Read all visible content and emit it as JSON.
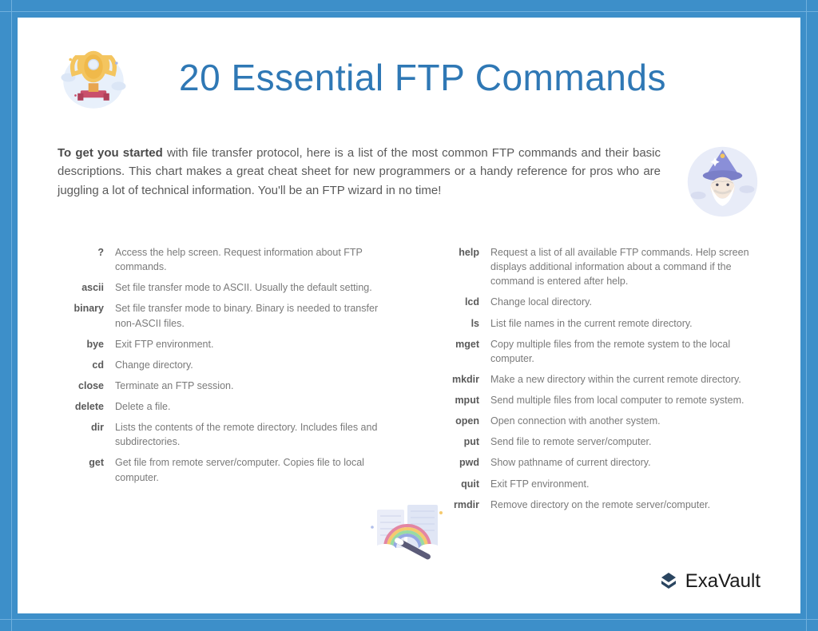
{
  "title": "20 Essential FTP Commands",
  "intro_lead": "To get you started",
  "intro_body": " with file transfer protocol, here is a list of the most common FTP commands and their basic descriptions. This chart makes a great cheat sheet for new programmers or a handy reference for pros who are juggling a lot of technical information. You'll be an FTP wizard in no time!",
  "brand": "ExaVault",
  "commands_left": [
    {
      "name": "?",
      "desc": "Access the help screen. Request information about FTP commands."
    },
    {
      "name": "ascii",
      "desc": "Set file transfer mode to ASCII. Usually the default setting."
    },
    {
      "name": "binary",
      "desc": "Set file transfer mode to binary. Binary is needed to transfer non-ASCII files."
    },
    {
      "name": "bye",
      "desc": "Exit FTP environment."
    },
    {
      "name": "cd",
      "desc": "Change directory."
    },
    {
      "name": "close",
      "desc": "Terminate an FTP session."
    },
    {
      "name": "delete",
      "desc": "Delete a file."
    },
    {
      "name": "dir",
      "desc": "Lists the contents of the remote directory. Includes files and subdirectories."
    },
    {
      "name": "get",
      "desc": "Get file from remote server/computer. Copies file to local computer."
    }
  ],
  "commands_right": [
    {
      "name": "help",
      "desc": "Request a list of all available FTP commands. Help screen displays additional information about a command if the command is entered after help."
    },
    {
      "name": "lcd",
      "desc": "Change local directory."
    },
    {
      "name": "ls",
      "desc": "List file names in the current remote directory."
    },
    {
      "name": "mget",
      "desc": "Copy multiple files from the remote system to the local computer."
    },
    {
      "name": "mkdir",
      "desc": "Make a new directory within the current remote directory."
    },
    {
      "name": "mput",
      "desc": "Send multiple files from local computer to remote system."
    },
    {
      "name": "open",
      "desc": "Open connection with another system."
    },
    {
      "name": "put",
      "desc": "Send file to remote server/computer."
    },
    {
      "name": "pwd",
      "desc": "Show pathname of current directory."
    },
    {
      "name": "quit",
      "desc": "Exit FTP environment."
    },
    {
      "name": "rmdir",
      "desc": "Remove directory on the remote server/computer."
    }
  ]
}
